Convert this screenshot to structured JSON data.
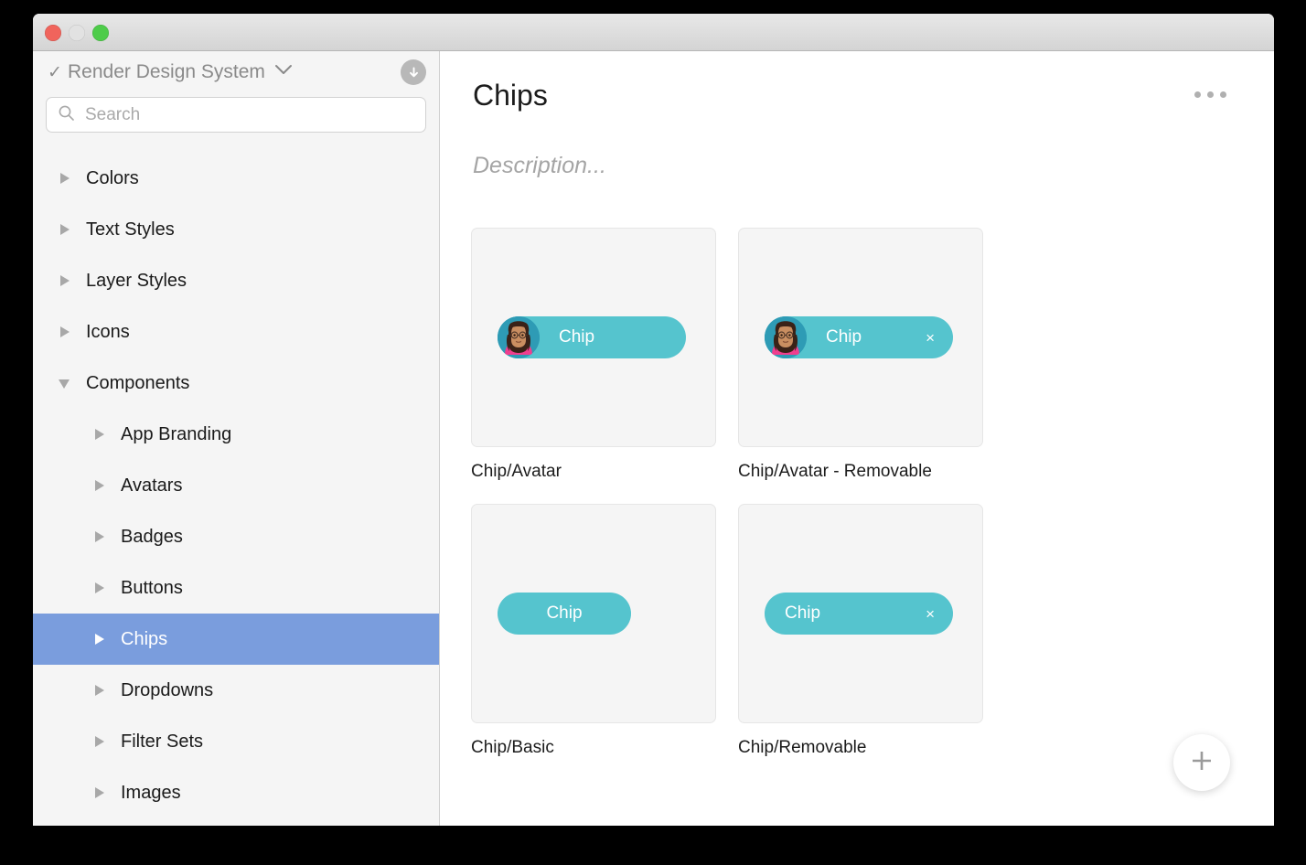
{
  "window": {
    "traffic_lights": [
      "close",
      "minimize",
      "zoom"
    ]
  },
  "sidebar": {
    "library": {
      "check_icon": "check-icon",
      "name": "Render Design System",
      "chevron_icon": "chevron-down-icon",
      "download_icon": "download-icon"
    },
    "search": {
      "icon": "search-icon",
      "placeholder": "Search",
      "value": ""
    },
    "tree": [
      {
        "label": "Colors",
        "level": 0,
        "expanded": false,
        "selected": false
      },
      {
        "label": "Text Styles",
        "level": 0,
        "expanded": false,
        "selected": false
      },
      {
        "label": "Layer Styles",
        "level": 0,
        "expanded": false,
        "selected": false
      },
      {
        "label": "Icons",
        "level": 0,
        "expanded": false,
        "selected": false
      },
      {
        "label": "Components",
        "level": 0,
        "expanded": true,
        "selected": false
      },
      {
        "label": "App Branding",
        "level": 1,
        "expanded": false,
        "selected": false
      },
      {
        "label": "Avatars",
        "level": 1,
        "expanded": false,
        "selected": false
      },
      {
        "label": "Badges",
        "level": 1,
        "expanded": false,
        "selected": false
      },
      {
        "label": "Buttons",
        "level": 1,
        "expanded": false,
        "selected": false
      },
      {
        "label": "Chips",
        "level": 1,
        "expanded": false,
        "selected": true
      },
      {
        "label": "Dropdowns",
        "level": 1,
        "expanded": false,
        "selected": false
      },
      {
        "label": "Filter Sets",
        "level": 1,
        "expanded": false,
        "selected": false
      },
      {
        "label": "Images",
        "level": 1,
        "expanded": false,
        "selected": false
      }
    ]
  },
  "main": {
    "title": "Chips",
    "overflow_icon": "ellipsis-icon",
    "description_placeholder": "Description...",
    "add_icon": "plus-icon",
    "cards": [
      {
        "label": "Chip/Avatar",
        "chip": {
          "text": "Chip",
          "has_avatar": true,
          "removable": false,
          "avatar_icon": "woman-avatar",
          "close_icon": ""
        }
      },
      {
        "label": "Chip/Avatar - Removable",
        "chip": {
          "text": "Chip",
          "has_avatar": true,
          "removable": true,
          "avatar_icon": "woman-avatar",
          "close_icon": "×"
        }
      },
      {
        "label": "Chip/Basic",
        "chip": {
          "text": "Chip",
          "has_avatar": false,
          "removable": false,
          "avatar_icon": "",
          "close_icon": ""
        }
      },
      {
        "label": "Chip/Removable",
        "chip": {
          "text": "Chip",
          "has_avatar": false,
          "removable": true,
          "avatar_icon": "",
          "close_icon": "×"
        }
      }
    ]
  },
  "colors": {
    "chip_teal": "#55c4ce",
    "selection_blue": "#7a9ddd",
    "sidebar_bg": "#f5f5f5",
    "card_bg": "#f5f5f5",
    "card_border": "#e6e6e6",
    "muted_text": "#a5a5a5"
  }
}
